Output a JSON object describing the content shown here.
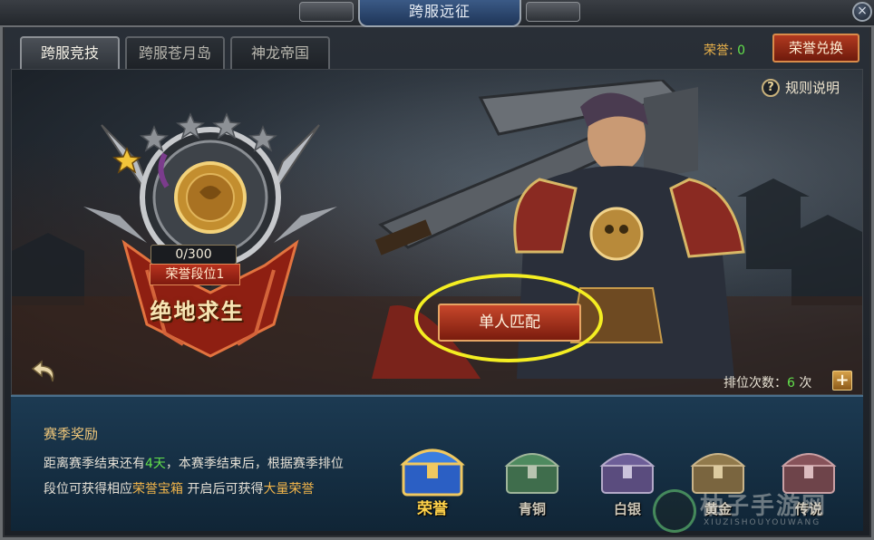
{
  "window": {
    "title": "跨服远征",
    "close_label": "×"
  },
  "tabs": [
    {
      "label": "跨服竞技",
      "active": true
    },
    {
      "label": "跨服苍月岛",
      "active": false
    },
    {
      "label": "神龙帝国",
      "active": false
    }
  ],
  "honor": {
    "label": "荣誉: ",
    "value": "0",
    "exchange_button": "荣誉兑换"
  },
  "rules": {
    "icon": "?",
    "label": "规则说明"
  },
  "rank": {
    "progress": "0/300",
    "progress_fraction": 0,
    "tier": "荣誉段位1",
    "name": "绝地求生",
    "stars_total": 5,
    "stars_filled": 1
  },
  "match_button": "单人匹配",
  "rank_count": {
    "label": "排位次数：",
    "value": "6",
    "unit": " 次",
    "plus": "+"
  },
  "season": {
    "title": "赛季奖励",
    "desc_1": "距离赛季结束还有",
    "days": "4天",
    "desc_2": "，本赛季结束后，根据赛季排位",
    "desc_3": "段位可获得相应",
    "chest_name": "荣誉宝箱",
    "desc_4": " 开启后可获得",
    "reward_name": "大量荣誉"
  },
  "chests": [
    {
      "label": "荣誉",
      "color": "#3b6fd1"
    },
    {
      "label": "青铜",
      "color": "#4b7d5a"
    },
    {
      "label": "白银",
      "color": "#6b5a8e"
    },
    {
      "label": "黄金",
      "color": "#8a7346"
    },
    {
      "label": "传说",
      "color": "#7a4c52"
    }
  ],
  "watermark": {
    "title": "柚子手游网",
    "sub": "XIUZISHOUYOUWANG"
  },
  "colors": {
    "accent_red": "#b23a20",
    "green_value": "#62e04b",
    "gold_text": "#f0b44a",
    "highlight_ring": "#f4ee22"
  }
}
